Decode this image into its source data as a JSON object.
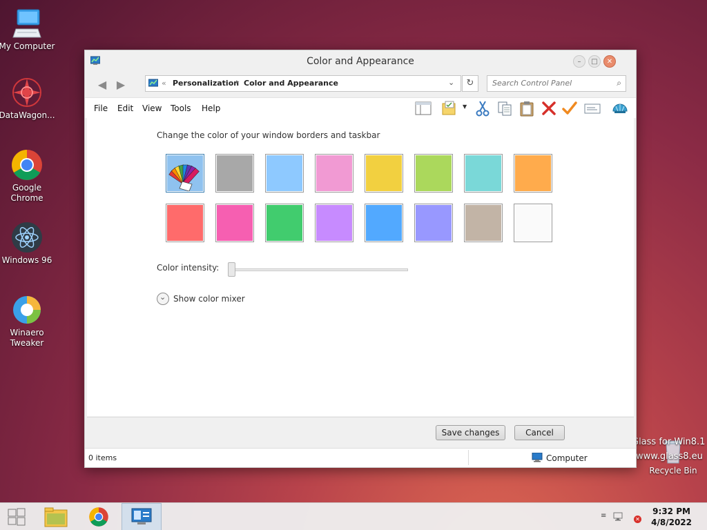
{
  "desktop": {
    "icons": [
      {
        "label": "My Computer"
      },
      {
        "label": "DataWagon..."
      },
      {
        "label": "Google Chrome"
      },
      {
        "label": "Windows 96"
      },
      {
        "label": "Winaero Tweaker"
      },
      {
        "label": "Recycle Bin"
      }
    ],
    "watermark_line1": "Glass for Win8.1",
    "watermark_line2": "www.glass8.eu"
  },
  "window": {
    "title": "Color and Appearance",
    "address": {
      "separator": "«",
      "crumbs": [
        "Personalization",
        "Color and Appearance"
      ]
    },
    "search_placeholder": "Search Control Panel",
    "menu": [
      "File",
      "Edit",
      "View",
      "Tools",
      "Help"
    ],
    "content": {
      "heading": "Change the color of your window borders and taskbar",
      "swatches": [
        {
          "color": "automatic",
          "selected": true
        },
        {
          "color": "#a8a8a8"
        },
        {
          "color": "#8ec9ff"
        },
        {
          "color": "#f19ad3"
        },
        {
          "color": "#f2d040"
        },
        {
          "color": "#abd85c"
        },
        {
          "color": "#7ad8d8"
        },
        {
          "color": "#ffab4c"
        },
        {
          "color": "#ff6b6b"
        },
        {
          "color": "#f65fb1"
        },
        {
          "color": "#41cc6e"
        },
        {
          "color": "#c78bff"
        },
        {
          "color": "#52a9ff"
        },
        {
          "color": "#9898ff"
        },
        {
          "color": "#c2b4a6"
        },
        {
          "color": "#fafafa"
        }
      ],
      "intensity_label": "Color intensity:",
      "intensity_value": 0,
      "mixer_label": "Show color mixer"
    },
    "buttons": {
      "save": "Save changes",
      "cancel": "Cancel"
    },
    "status": {
      "items": "0 items",
      "location": "Computer"
    }
  },
  "taskbar": {
    "time": "9:32 PM",
    "date": "4/8/2022"
  }
}
